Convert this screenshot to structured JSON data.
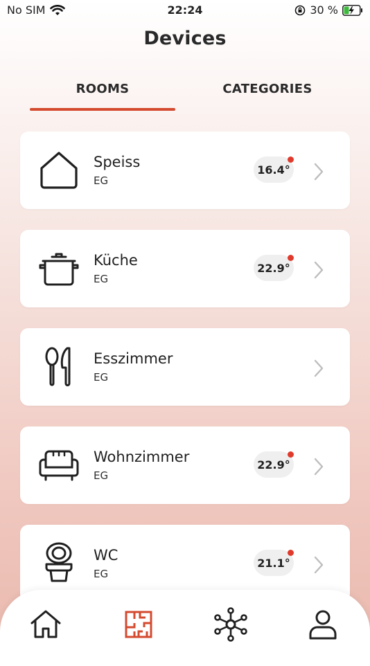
{
  "status_bar": {
    "carrier": "No SIM",
    "time": "22:24",
    "battery_percent": "30 %"
  },
  "page_title": "Devices",
  "tabs": [
    {
      "label": "ROOMS",
      "active": true
    },
    {
      "label": "CATEGORIES",
      "active": false
    }
  ],
  "rooms": [
    {
      "name": "Speiss",
      "floor": "EG",
      "temperature": "16.4°",
      "icon": "house-icon",
      "alert": true
    },
    {
      "name": "Küche",
      "floor": "EG",
      "temperature": "22.9°",
      "icon": "pot-icon",
      "alert": true
    },
    {
      "name": "Esszimmer",
      "floor": "EG",
      "temperature": "",
      "icon": "cutlery-icon",
      "alert": false
    },
    {
      "name": "Wohnzimmer",
      "floor": "EG",
      "temperature": "22.9°",
      "icon": "armchair-icon",
      "alert": true
    },
    {
      "name": "WC",
      "floor": "EG",
      "temperature": "21.1°",
      "icon": "toilet-icon",
      "alert": true
    }
  ],
  "bottom_nav": [
    {
      "name": "home",
      "icon": "home-icon",
      "active": false
    },
    {
      "name": "rooms",
      "icon": "floorplan-icon",
      "active": true
    },
    {
      "name": "network",
      "icon": "network-icon",
      "active": false
    },
    {
      "name": "profile",
      "icon": "user-icon",
      "active": false
    }
  ],
  "colors": {
    "accent": "#d44a2f",
    "alert_dot": "#e03a2c",
    "card": "#ffffff",
    "badge": "#efefef",
    "text": "#1f1f1f"
  }
}
